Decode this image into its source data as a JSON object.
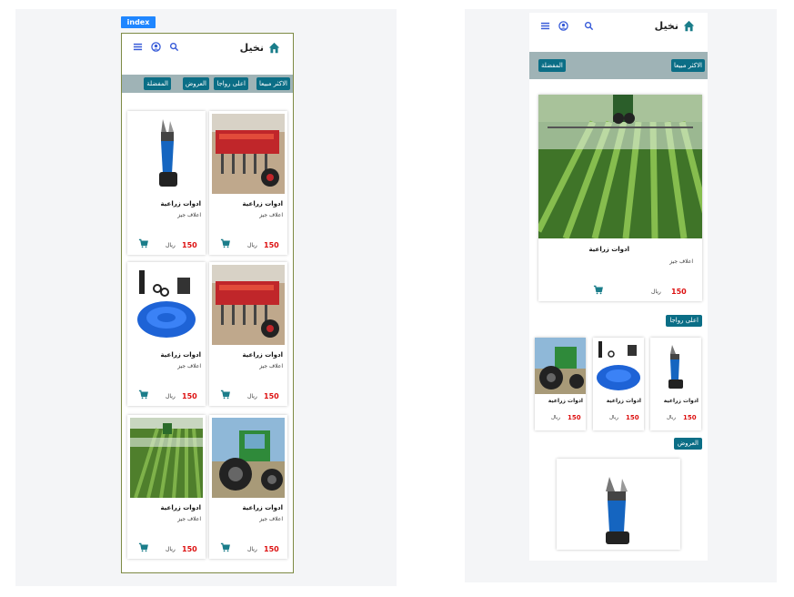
{
  "artboard_label": "index",
  "brand": {
    "name": "نخيل"
  },
  "tabs": [
    "الاكثر مبيعا",
    "اعلى رواجا",
    "العروض",
    "المفضلة"
  ],
  "right_tabs": [
    "الاكثر مبيعا",
    "المفضلة"
  ],
  "product_common": {
    "title": "ادوات زراعية",
    "subtitle": "اعلاف جيز",
    "price": "150",
    "currency": "ريال"
  },
  "left_grid": [
    {
      "image": "seed-drill-machine"
    },
    {
      "image": "electric-pruner"
    },
    {
      "image": "seed-drill-machine"
    },
    {
      "image": "blue-garden-hose"
    },
    {
      "image": "tractor"
    },
    {
      "image": "field-sprayer"
    }
  ],
  "right": {
    "hero": {
      "image": "field-sprayer"
    },
    "section_trending": "اعلى رواجا",
    "section_offers": "العروض",
    "mini_cards": [
      {
        "image": "electric-pruner"
      },
      {
        "image": "blue-garden-hose"
      },
      {
        "image": "tractor"
      }
    ],
    "bottom": {
      "image": "electric-pruner"
    }
  },
  "colors": {
    "accent": "#0b6e86",
    "tabbar": "#9fb3b6",
    "price": "#dd1111",
    "icon": "#3559d8",
    "tag": "#1f86ff"
  }
}
